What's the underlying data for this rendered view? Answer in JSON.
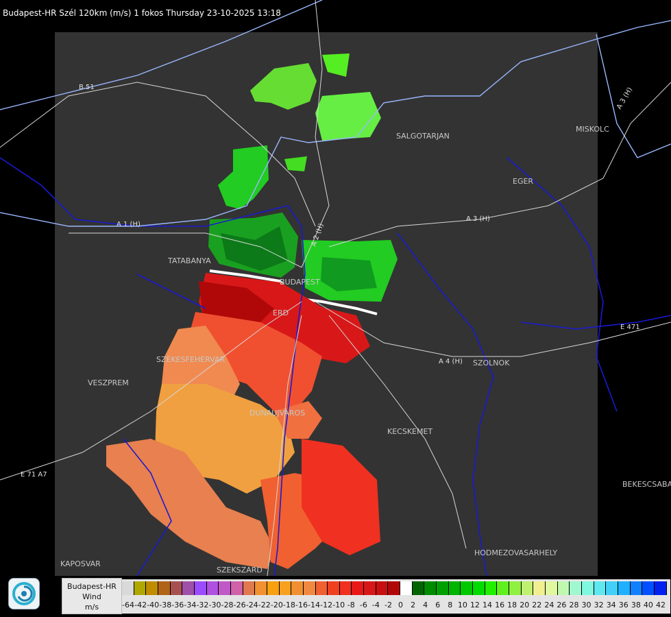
{
  "header": {
    "title": "Budapest-HR Szél 120km (m/s) 1 fokos Thursday 23-10-2025 13:18"
  },
  "map": {
    "cities": [
      "SALGOTARJAN",
      "MISKOLC",
      "EGER",
      "TATABANYA",
      "BUDAPEST",
      "ERD",
      "SZEKESFEHERVAR",
      "VESZPREM",
      "DUNAUJVAROS",
      "KECSKEMET",
      "SZOLNOK",
      "BEKESCSABA",
      "HODMEZOVASARHELY",
      "KAPOSVAR",
      "SZEKSZARD"
    ],
    "roads": [
      "B 51",
      "A 1 (H)",
      "A 2 (H)",
      "A 3 (H)",
      "A 4 (H)",
      "E 471",
      "E 71 A7",
      "A 3 (H)"
    ],
    "colors": {
      "background": "#000000",
      "radar_range": "#333333",
      "rivers": "#1a1ad0",
      "roads": "#e8e8e8",
      "borders": "#8fb0ff"
    }
  },
  "legend": {
    "station": "Budapest-HR",
    "product": "Wind",
    "unit": "m/s",
    "colors": [
      "#d9d9d9",
      "#b0a800",
      "#c08c00",
      "#b06418",
      "#a85050",
      "#a050a8",
      "#9c4cff",
      "#b050e0",
      "#c058c8",
      "#d060a8",
      "#e07850",
      "#f09030",
      "#f8a010",
      "#f8a020",
      "#f09030",
      "#f08840",
      "#f06030",
      "#f04020",
      "#f03020",
      "#e81818",
      "#d81818",
      "#c81010",
      "#b00808",
      "#ffffff",
      "#006400",
      "#008c00",
      "#00a000",
      "#00b400",
      "#00c800",
      "#00dc00",
      "#20f000",
      "#60f020",
      "#90f040",
      "#c0f070",
      "#f0f090",
      "#e0f8a0",
      "#c0f8b0",
      "#a0f8d0",
      "#80f8e0",
      "#60e8f0",
      "#40d0f8",
      "#20b0ff",
      "#1080ff",
      "#0050ff",
      "#0020f0"
    ],
    "ticks": [
      "-64",
      "-42",
      "-40",
      "-38",
      "-36",
      "-34",
      "-32",
      "-30",
      "-28",
      "-26",
      "-24",
      "-22",
      "-20",
      "-18",
      "-16",
      "-14",
      "-12",
      "-10",
      "-8",
      "-6",
      "-4",
      "-2",
      "0",
      "2",
      "4",
      "6",
      "8",
      "10",
      "12",
      "14",
      "16",
      "18",
      "20",
      "22",
      "24",
      "26",
      "28",
      "30",
      "32",
      "34",
      "36",
      "38",
      "40",
      "42"
    ]
  }
}
